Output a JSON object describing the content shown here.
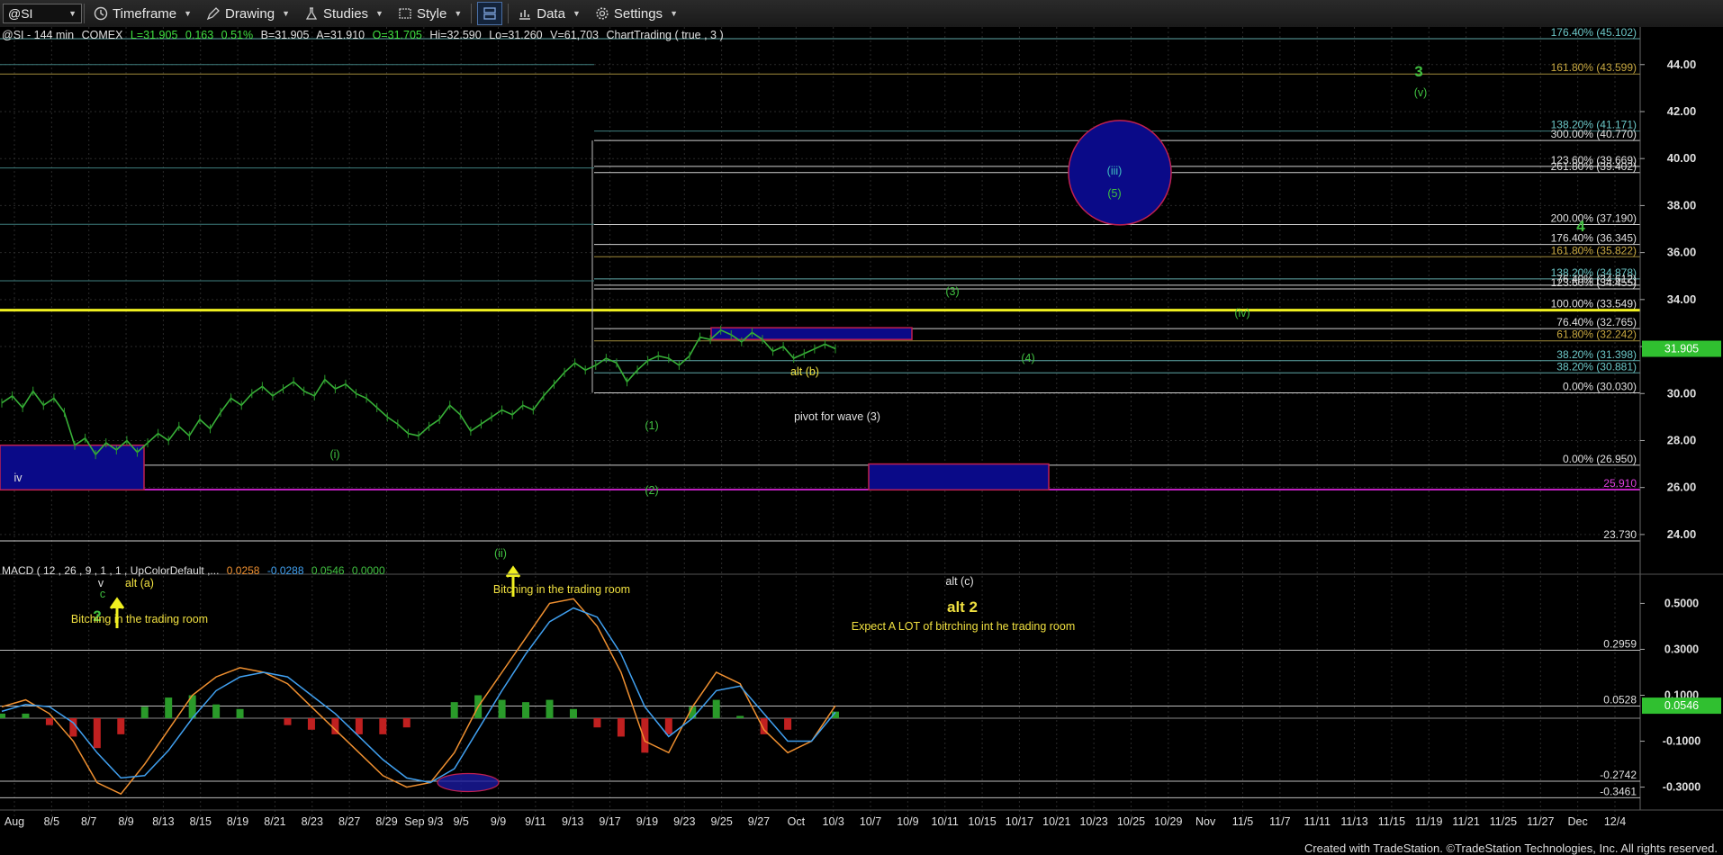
{
  "toolbar": {
    "symbol": "@SI",
    "timeframe": "Timeframe",
    "drawing": "Drawing",
    "studies": "Studies",
    "style": "Style",
    "data": "Data",
    "settings": "Settings"
  },
  "header": {
    "symbol": "@SI",
    "interval": "144 min",
    "exchange": "COMEX",
    "last": "L=31.905",
    "change": "0.163",
    "pct": "0.51%",
    "bid": "B=31.905",
    "ask": "A=31.910",
    "open": "O=31.705",
    "high": "Hi=32.590",
    "low": "Lo=31.260",
    "volume": "V=61,703",
    "study": "ChartTrading ( true , 3 )"
  },
  "macd_header": {
    "label": "MACD ( 12 , 26 , 9 , 1 , 1 , UpColorDefault ,...",
    "v1": "0.0258",
    "v2": "-0.0288",
    "v3": "0.0546",
    "v4": "0.0000"
  },
  "footer": "Created with TradeStation. ©TradeStation Technologies, Inc. All rights reserved.",
  "chart_data": [
    {
      "type": "line",
      "title": "@SI - 144 min COMEX",
      "price_ticks": [
        24,
        26,
        28,
        30,
        32,
        34,
        36,
        38,
        40,
        42,
        44
      ],
      "ylim": [
        23.0,
        45.6
      ],
      "last_price": "31.905",
      "date_ticks": [
        "Aug",
        "8/5",
        "8/7",
        "8/9",
        "8/13",
        "8/15",
        "8/19",
        "8/21",
        "8/23",
        "8/27",
        "8/29",
        "Sep 9/3",
        "9/5",
        "9/9",
        "9/11",
        "9/13",
        "9/17",
        "9/19",
        "9/23",
        "9/25",
        "9/27",
        "Oct",
        "10/3",
        "10/7",
        "10/9",
        "10/11",
        "10/15",
        "10/17",
        "10/21",
        "10/23",
        "10/25",
        "10/29",
        "Nov",
        "11/5",
        "11/7",
        "11/11",
        "11/13",
        "11/15",
        "11/19",
        "11/21",
        "11/25",
        "11/27",
        "Dec",
        "12/4"
      ],
      "series": [
        {
          "values": [
            29.6,
            29.9,
            29.4,
            30.1,
            29.5,
            29.8,
            29.2,
            27.8,
            28.1,
            27.4,
            27.9,
            27.6,
            28.0,
            27.5,
            27.9,
            28.3,
            28.0,
            28.6,
            28.2,
            28.9,
            28.5,
            29.2,
            29.8,
            29.5,
            30.0,
            30.3,
            29.9,
            30.2,
            30.5,
            30.1,
            29.9,
            30.6,
            30.2,
            30.4,
            30.0,
            29.8,
            29.4,
            29.0,
            28.7,
            28.3,
            28.2,
            28.6,
            28.9,
            29.5,
            29.1,
            28.4,
            28.7,
            29.0,
            29.3,
            29.1,
            29.5,
            29.3,
            29.9,
            30.4,
            30.9,
            31.3,
            31.0,
            31.2,
            31.5,
            31.3,
            30.5,
            31.0,
            31.4,
            31.6,
            31.5,
            31.2,
            31.6,
            32.4,
            32.3,
            32.7,
            32.5,
            32.2,
            32.6,
            32.3,
            31.8,
            32.0,
            31.5,
            31.7,
            31.9,
            32.1,
            31.905
          ]
        }
      ],
      "horizontal_levels": [
        {
          "label": "176.40% (45.102)",
          "price": 45.102,
          "color": "#5fa8a8"
        },
        {
          "label": "161.80% (43.599)",
          "price": 43.599,
          "color": "#a08a3a"
        },
        {
          "label": "138.20% (41.171)",
          "price": 41.171,
          "color": "#3f7f7f"
        },
        {
          "label": "300.00% (40.770)",
          "price": 40.77,
          "color": "#d0d0d0"
        },
        {
          "label": "123.60% (39.669)",
          "price": 39.669,
          "color": "#d0d0d0"
        },
        {
          "label": "261.80% (39.402)",
          "price": 39.402,
          "color": "#d0d0d0"
        },
        {
          "label": "200.00% (37.190)",
          "price": 37.19,
          "color": "#d0d0d0"
        },
        {
          "label": "176.40% (36.345)",
          "price": 36.345,
          "color": "#d0d0d0"
        },
        {
          "label": "161.80% (35.822)",
          "price": 35.822,
          "color": "#a08a3a"
        },
        {
          "label": "138.20% (34.878)",
          "price": 34.878,
          "color": "#5fa8a8"
        },
        {
          "label": "76.40% (34.612)",
          "price": 34.612,
          "color": "#d0d0d0"
        },
        {
          "label": "123.60% (34.455)",
          "price": 34.455,
          "color": "#d0d0d0"
        },
        {
          "label": "100.00% (33.549)",
          "price": 33.549,
          "color": "#d0d0d0"
        },
        {
          "label": "76.40% (32.765)",
          "price": 32.765,
          "color": "#d0d0d0"
        },
        {
          "label": "61.80% (32.242)",
          "price": 32.242,
          "color": "#a08a3a"
        },
        {
          "label": "38.20% (31.398)",
          "price": 31.398,
          "color": "#5fa8a8"
        },
        {
          "label": "38.20% (30.881)",
          "price": 30.881,
          "color": "#5fa8a8"
        },
        {
          "label": "0.00% (30.030)",
          "price": 30.03,
          "color": "#d0d0d0"
        },
        {
          "label": "0.00% (26.950)",
          "price": 26.95,
          "color": "#d0d0d0"
        },
        {
          "label": "25.910",
          "price": 25.91,
          "color": "#c020c0"
        },
        {
          "label": "23.730",
          "price": 23.73,
          "color": "#d0d0d0"
        }
      ],
      "yellow_line": 33.55,
      "annotations": [
        {
          "text": "iv",
          "color": "#e0e0e0"
        },
        {
          "text": "(i)",
          "color": "#40c040"
        },
        {
          "text": "v",
          "color": "#e0e0e0"
        },
        {
          "text": "c",
          "color": "#40c040"
        },
        {
          "text": "2",
          "color": "#40c040"
        },
        {
          "text": "alt (a)",
          "color": "#f0e040"
        },
        {
          "text": "Bitching in the trading room",
          "color": "#f0e040"
        },
        {
          "text": "(ii)",
          "color": "#40c040"
        },
        {
          "text": "Bitching in the trading room",
          "color": "#f0e040"
        },
        {
          "text": "(1)",
          "color": "#40c040"
        },
        {
          "text": "(2)",
          "color": "#40c040"
        },
        {
          "text": "alt (b)",
          "color": "#f0e040"
        },
        {
          "text": "pivot for wave (3)",
          "color": "#e0e0e0"
        },
        {
          "text": "(3)",
          "color": "#40c040"
        },
        {
          "text": "(4)",
          "color": "#40c040"
        },
        {
          "text": "(iii)",
          "color": "#40c0c0"
        },
        {
          "text": "(5)",
          "color": "#40c040"
        },
        {
          "text": "(iv)",
          "color": "#40c040"
        },
        {
          "text": "3",
          "color": "#40c040"
        },
        {
          "text": "(v)",
          "color": "#40c040"
        },
        {
          "text": "4",
          "color": "#40c040"
        },
        {
          "text": "alt (c)",
          "color": "#e0e0e0"
        },
        {
          "text": "alt 2",
          "color": "#f0e040"
        },
        {
          "text": "Expect A LOT of bitrching int he trading room",
          "color": "#f0e040"
        }
      ]
    },
    {
      "type": "line",
      "title": "MACD",
      "ticks": [
        "0.5000",
        "0.3000",
        "0.1000",
        "-0.1000",
        "-0.3000"
      ],
      "tick_values": [
        0.5,
        0.3,
        0.1,
        -0.1,
        -0.3
      ],
      "ylim": [
        -0.38,
        0.58
      ],
      "levels": [
        {
          "label": "0.2959",
          "value": 0.2959
        },
        {
          "label": "0.0528",
          "value": 0.0528
        },
        {
          "label": "-0.2742",
          "value": -0.2742
        },
        {
          "label": "-0.3461",
          "value": -0.3461
        }
      ],
      "last_value": "0.0546",
      "macd": [
        0.05,
        0.08,
        0.02,
        -0.1,
        -0.28,
        -0.33,
        -0.2,
        -0.05,
        0.1,
        0.18,
        0.22,
        0.2,
        0.15,
        0.05,
        -0.05,
        -0.15,
        -0.25,
        -0.3,
        -0.28,
        -0.15,
        0.05,
        0.2,
        0.35,
        0.5,
        0.52,
        0.4,
        0.2,
        -0.1,
        -0.15,
        0.05,
        0.2,
        0.15,
        -0.05,
        -0.15,
        -0.1,
        0.0546
      ],
      "signal": [
        0.03,
        0.06,
        0.05,
        -0.02,
        -0.15,
        -0.26,
        -0.25,
        -0.14,
        0.0,
        0.12,
        0.18,
        0.2,
        0.18,
        0.1,
        0.02,
        -0.08,
        -0.18,
        -0.26,
        -0.28,
        -0.22,
        -0.05,
        0.12,
        0.28,
        0.42,
        0.48,
        0.44,
        0.28,
        0.05,
        -0.08,
        0.0,
        0.12,
        0.14,
        0.02,
        -0.1,
        -0.1,
        0.0258
      ]
    }
  ]
}
